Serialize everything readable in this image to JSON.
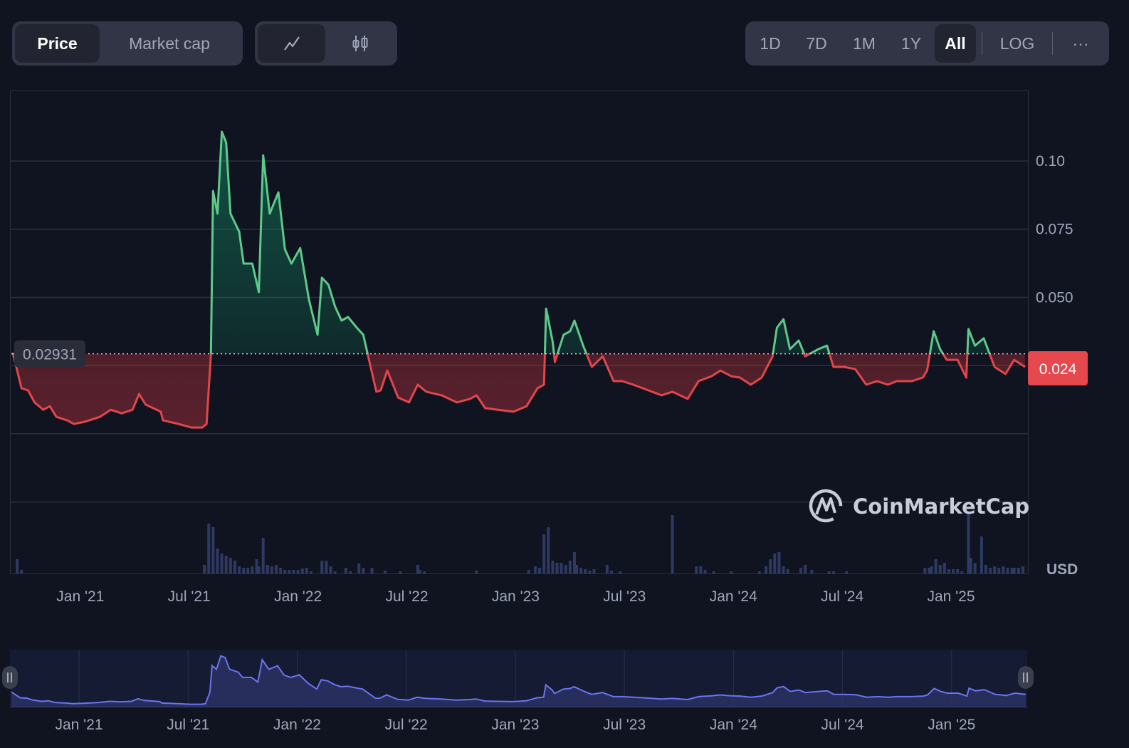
{
  "toolbar": {
    "metric_tabs": [
      {
        "label": "Price",
        "active": true
      },
      {
        "label": "Market cap",
        "active": false
      }
    ],
    "chart_type_buttons": [
      {
        "icon": "line-chart-icon",
        "active": true
      },
      {
        "icon": "candlestick-icon",
        "active": false
      }
    ],
    "ranges": [
      {
        "label": "1D",
        "active": false
      },
      {
        "label": "7D",
        "active": false
      },
      {
        "label": "1M",
        "active": false
      },
      {
        "label": "1Y",
        "active": false
      },
      {
        "label": "All",
        "active": true
      }
    ],
    "log_label": "LOG",
    "more_label": "···"
  },
  "watermark": "CoinMarketCap",
  "currency_label": "USD",
  "reference_price_label": "0.02931",
  "current_price_label": "0.024",
  "colors": {
    "up": "#16c784",
    "up_line": "#5fc98a",
    "down": "#ea3943",
    "down_line": "#e0464b",
    "current_badge": "#e5484d",
    "navigator": "#6a74f0",
    "volume": "#2e3a63"
  },
  "chart_data": {
    "type": "line",
    "title": "",
    "xlabel": "",
    "ylabel": "USD",
    "xlim": [
      2020.69,
      2025.34
    ],
    "ylim": [
      -0.0251,
      0.1256
    ],
    "grid": true,
    "reference_value": 0.02931,
    "current_value": 0.024,
    "y_ticks": [
      {
        "value": 0.1,
        "label": "0.10"
      },
      {
        "value": 0.075,
        "label": "0.075"
      },
      {
        "value": 0.05,
        "label": "0.050"
      }
    ],
    "y_gridlines": [
      0.1,
      0.075,
      0.05,
      0.025,
      0,
      -0.025
    ],
    "x_ticks": [
      {
        "value": 2021.0,
        "label": "Jan '21"
      },
      {
        "value": 2021.5,
        "label": "Jul '21"
      },
      {
        "value": 2022.0,
        "label": "Jan '22"
      },
      {
        "value": 2022.5,
        "label": "Jul '22"
      },
      {
        "value": 2023.0,
        "label": "Jan '23"
      },
      {
        "value": 2023.5,
        "label": "Jul '23"
      },
      {
        "value": 2024.0,
        "label": "Jan '24"
      },
      {
        "value": 2024.5,
        "label": "Jul '24"
      },
      {
        "value": 2025.0,
        "label": "Jan '25"
      }
    ],
    "series": [
      {
        "name": "Price",
        "points": [
          [
            2020.69,
            0.0297
          ],
          [
            2020.73,
            0.0167
          ],
          [
            2020.76,
            0.0159
          ],
          [
            2020.79,
            0.0115
          ],
          [
            2020.83,
            0.0088
          ],
          [
            2020.86,
            0.0101
          ],
          [
            2020.89,
            0.0062
          ],
          [
            2020.94,
            0.0049
          ],
          [
            2020.97,
            0.0036
          ],
          [
            2021.02,
            0.0044
          ],
          [
            2021.09,
            0.0062
          ],
          [
            2021.14,
            0.0088
          ],
          [
            2021.19,
            0.0075
          ],
          [
            2021.24,
            0.0088
          ],
          [
            2021.27,
            0.0146
          ],
          [
            2021.3,
            0.0107
          ],
          [
            2021.37,
            0.0081
          ],
          [
            2021.38,
            0.0049
          ],
          [
            2021.45,
            0.0036
          ],
          [
            2021.51,
            0.0023
          ],
          [
            2021.56,
            0.0023
          ],
          [
            2021.58,
            0.0036
          ],
          [
            2021.6,
            0.0292
          ],
          [
            2021.61,
            0.089
          ],
          [
            2021.63,
            0.0807
          ],
          [
            2021.65,
            0.1107
          ],
          [
            2021.67,
            0.1068
          ],
          [
            2021.69,
            0.0807
          ],
          [
            2021.73,
            0.0741
          ],
          [
            2021.75,
            0.0624
          ],
          [
            2021.79,
            0.0624
          ],
          [
            2021.82,
            0.0519
          ],
          [
            2021.84,
            0.1021
          ],
          [
            2021.87,
            0.0807
          ],
          [
            2021.91,
            0.0885
          ],
          [
            2021.94,
            0.0676
          ],
          [
            2021.97,
            0.0624
          ],
          [
            2022.01,
            0.0681
          ],
          [
            2022.05,
            0.0493
          ],
          [
            2022.09,
            0.0363
          ],
          [
            2022.11,
            0.0572
          ],
          [
            2022.14,
            0.0546
          ],
          [
            2022.17,
            0.0467
          ],
          [
            2022.2,
            0.0415
          ],
          [
            2022.23,
            0.0428
          ],
          [
            2022.27,
            0.0389
          ],
          [
            2022.3,
            0.0363
          ],
          [
            2022.33,
            0.0258
          ],
          [
            2022.36,
            0.0154
          ],
          [
            2022.38,
            0.0159
          ],
          [
            2022.41,
            0.0232
          ],
          [
            2022.46,
            0.0133
          ],
          [
            2022.51,
            0.0115
          ],
          [
            2022.55,
            0.018
          ],
          [
            2022.59,
            0.0154
          ],
          [
            2022.66,
            0.0141
          ],
          [
            2022.73,
            0.0115
          ],
          [
            2022.79,
            0.0128
          ],
          [
            2022.82,
            0.0141
          ],
          [
            2022.86,
            0.0094
          ],
          [
            2022.92,
            0.0088
          ],
          [
            2022.99,
            0.0081
          ],
          [
            2023.05,
            0.0101
          ],
          [
            2023.1,
            0.0167
          ],
          [
            2023.13,
            0.018
          ],
          [
            2023.14,
            0.0459
          ],
          [
            2023.17,
            0.0337
          ],
          [
            2023.18,
            0.0263
          ],
          [
            2023.22,
            0.0363
          ],
          [
            2023.25,
            0.0376
          ],
          [
            2023.27,
            0.0415
          ],
          [
            2023.31,
            0.0323
          ],
          [
            2023.35,
            0.0245
          ],
          [
            2023.4,
            0.0284
          ],
          [
            2023.45,
            0.0193
          ],
          [
            2023.49,
            0.0193
          ],
          [
            2023.54,
            0.018
          ],
          [
            2023.61,
            0.0159
          ],
          [
            2023.67,
            0.0141
          ],
          [
            2023.72,
            0.0154
          ],
          [
            2023.79,
            0.0128
          ],
          [
            2023.84,
            0.0193
          ],
          [
            2023.9,
            0.0211
          ],
          [
            2023.94,
            0.0232
          ],
          [
            2023.99,
            0.0211
          ],
          [
            2024.03,
            0.0206
          ],
          [
            2024.08,
            0.018
          ],
          [
            2024.13,
            0.0206
          ],
          [
            2024.18,
            0.0284
          ],
          [
            2024.2,
            0.0389
          ],
          [
            2024.23,
            0.042
          ],
          [
            2024.26,
            0.031
          ],
          [
            2024.3,
            0.0342
          ],
          [
            2024.33,
            0.0284
          ],
          [
            2024.39,
            0.031
          ],
          [
            2024.43,
            0.0323
          ],
          [
            2024.46,
            0.0245
          ],
          [
            2024.51,
            0.0245
          ],
          [
            2024.56,
            0.0237
          ],
          [
            2024.61,
            0.018
          ],
          [
            2024.66,
            0.0193
          ],
          [
            2024.71,
            0.018
          ],
          [
            2024.75,
            0.0193
          ],
          [
            2024.82,
            0.0193
          ],
          [
            2024.87,
            0.0206
          ],
          [
            2024.89,
            0.0232
          ],
          [
            2024.92,
            0.0376
          ],
          [
            2024.95,
            0.031
          ],
          [
            2024.98,
            0.0271
          ],
          [
            2025.03,
            0.0271
          ],
          [
            2025.07,
            0.0206
          ],
          [
            2025.08,
            0.0384
          ],
          [
            2025.11,
            0.0323
          ],
          [
            2025.15,
            0.035
          ],
          [
            2025.2,
            0.0245
          ],
          [
            2025.25,
            0.0219
          ],
          [
            2025.29,
            0.0271
          ],
          [
            2025.34,
            0.0245
          ]
        ]
      },
      {
        "name": "Volume (relative)",
        "points": [
          [
            2020.71,
            20
          ],
          [
            2020.73,
            5
          ],
          [
            2021.57,
            12
          ],
          [
            2021.59,
            70
          ],
          [
            2021.61,
            65
          ],
          [
            2021.63,
            35
          ],
          [
            2021.65,
            28
          ],
          [
            2021.67,
            25
          ],
          [
            2021.69,
            22
          ],
          [
            2021.71,
            18
          ],
          [
            2021.73,
            10
          ],
          [
            2021.75,
            8
          ],
          [
            2021.77,
            8
          ],
          [
            2021.79,
            10
          ],
          [
            2021.81,
            20
          ],
          [
            2021.82,
            10
          ],
          [
            2021.84,
            50
          ],
          [
            2021.86,
            12
          ],
          [
            2021.88,
            10
          ],
          [
            2021.9,
            12
          ],
          [
            2021.92,
            8
          ],
          [
            2021.94,
            5
          ],
          [
            2021.96,
            5
          ],
          [
            2021.98,
            5
          ],
          [
            2022.0,
            5
          ],
          [
            2022.02,
            7
          ],
          [
            2022.04,
            8
          ],
          [
            2022.06,
            3
          ],
          [
            2022.11,
            18
          ],
          [
            2022.13,
            18
          ],
          [
            2022.15,
            10
          ],
          [
            2022.17,
            3
          ],
          [
            2022.22,
            8
          ],
          [
            2022.24,
            3
          ],
          [
            2022.28,
            14
          ],
          [
            2022.3,
            8
          ],
          [
            2022.34,
            8
          ],
          [
            2022.4,
            4
          ],
          [
            2022.47,
            3
          ],
          [
            2022.55,
            12
          ],
          [
            2022.56,
            5
          ],
          [
            2022.58,
            3
          ],
          [
            2022.82,
            4
          ],
          [
            2023.06,
            5
          ],
          [
            2023.09,
            10
          ],
          [
            2023.11,
            8
          ],
          [
            2023.13,
            55
          ],
          [
            2023.15,
            65
          ],
          [
            2023.17,
            18
          ],
          [
            2023.19,
            15
          ],
          [
            2023.21,
            15
          ],
          [
            2023.23,
            12
          ],
          [
            2023.25,
            18
          ],
          [
            2023.27,
            30
          ],
          [
            2023.28,
            12
          ],
          [
            2023.3,
            8
          ],
          [
            2023.32,
            6
          ],
          [
            2023.34,
            4
          ],
          [
            2023.36,
            6
          ],
          [
            2023.42,
            12
          ],
          [
            2023.44,
            4
          ],
          [
            2023.48,
            3
          ],
          [
            2023.72,
            82
          ],
          [
            2023.83,
            10
          ],
          [
            2023.85,
            10
          ],
          [
            2023.87,
            5
          ],
          [
            2023.91,
            3
          ],
          [
            2023.99,
            3
          ],
          [
            2024.12,
            3
          ],
          [
            2024.15,
            10
          ],
          [
            2024.17,
            20
          ],
          [
            2024.19,
            28
          ],
          [
            2024.21,
            30
          ],
          [
            2024.23,
            10
          ],
          [
            2024.25,
            6
          ],
          [
            2024.31,
            8
          ],
          [
            2024.33,
            12
          ],
          [
            2024.36,
            5
          ],
          [
            2024.44,
            3
          ],
          [
            2024.46,
            3
          ],
          [
            2024.52,
            3
          ],
          [
            2024.88,
            8
          ],
          [
            2024.9,
            8
          ],
          [
            2024.91,
            10
          ],
          [
            2024.93,
            20
          ],
          [
            2024.95,
            12
          ],
          [
            2024.97,
            15
          ],
          [
            2024.99,
            6
          ],
          [
            2025.01,
            6
          ],
          [
            2025.03,
            6
          ],
          [
            2025.05,
            3
          ],
          [
            2025.08,
            85
          ],
          [
            2025.09,
            22
          ],
          [
            2025.11,
            15
          ],
          [
            2025.14,
            52
          ],
          [
            2025.16,
            12
          ],
          [
            2025.18,
            8
          ],
          [
            2025.2,
            10
          ],
          [
            2025.22,
            8
          ],
          [
            2025.24,
            10
          ],
          [
            2025.26,
            8
          ],
          [
            2025.28,
            8
          ],
          [
            2025.29,
            8
          ],
          [
            2025.31,
            8
          ],
          [
            2025.33,
            10
          ]
        ]
      }
    ]
  }
}
